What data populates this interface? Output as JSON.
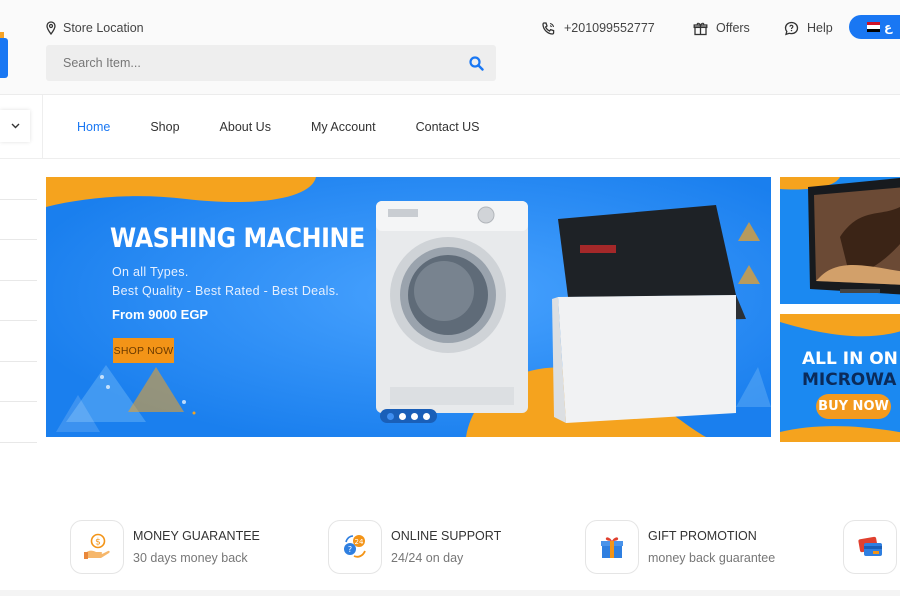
{
  "header": {
    "store_location": "Store Location",
    "search_placeholder": "Search Item...",
    "phone": "+201099552777",
    "offers": "Offers",
    "help": "Help",
    "language_label": "ع"
  },
  "nav": {
    "items": [
      {
        "label": "Home",
        "active": true
      },
      {
        "label": "Shop",
        "active": false
      },
      {
        "label": "About Us",
        "active": false
      },
      {
        "label": "My Account",
        "active": false
      },
      {
        "label": "Contact US",
        "active": false
      }
    ]
  },
  "hero": {
    "title": "WASHING MACHINE",
    "line1": "On all Types.",
    "line2": "Best Quality - Best Rated - Best Deals.",
    "price": "From 9000 EGP",
    "cta": "SHOP NOW",
    "slide_count": 4,
    "active_slide": 1
  },
  "side_banners": {
    "microwave_line1": "ALL IN ON",
    "microwave_line2": "MICROWA",
    "microwave_cta": "BUY NOW"
  },
  "features": [
    {
      "title": "MONEY GUARANTEE",
      "subtitle": "30 days money back",
      "icon": "money-hand-icon"
    },
    {
      "title": "ONLINE SUPPORT",
      "subtitle": "24/24 on day",
      "icon": "support-24-icon"
    },
    {
      "title": "GIFT PROMOTION",
      "subtitle": "money back guarantee",
      "icon": "gift-icon"
    },
    {
      "title": "",
      "subtitle": "",
      "icon": "payment-cards-icon"
    }
  ],
  "colors": {
    "brand_blue": "#1977f3",
    "accent_orange": "#f39417",
    "hero_blue": "#1f86f2"
  }
}
